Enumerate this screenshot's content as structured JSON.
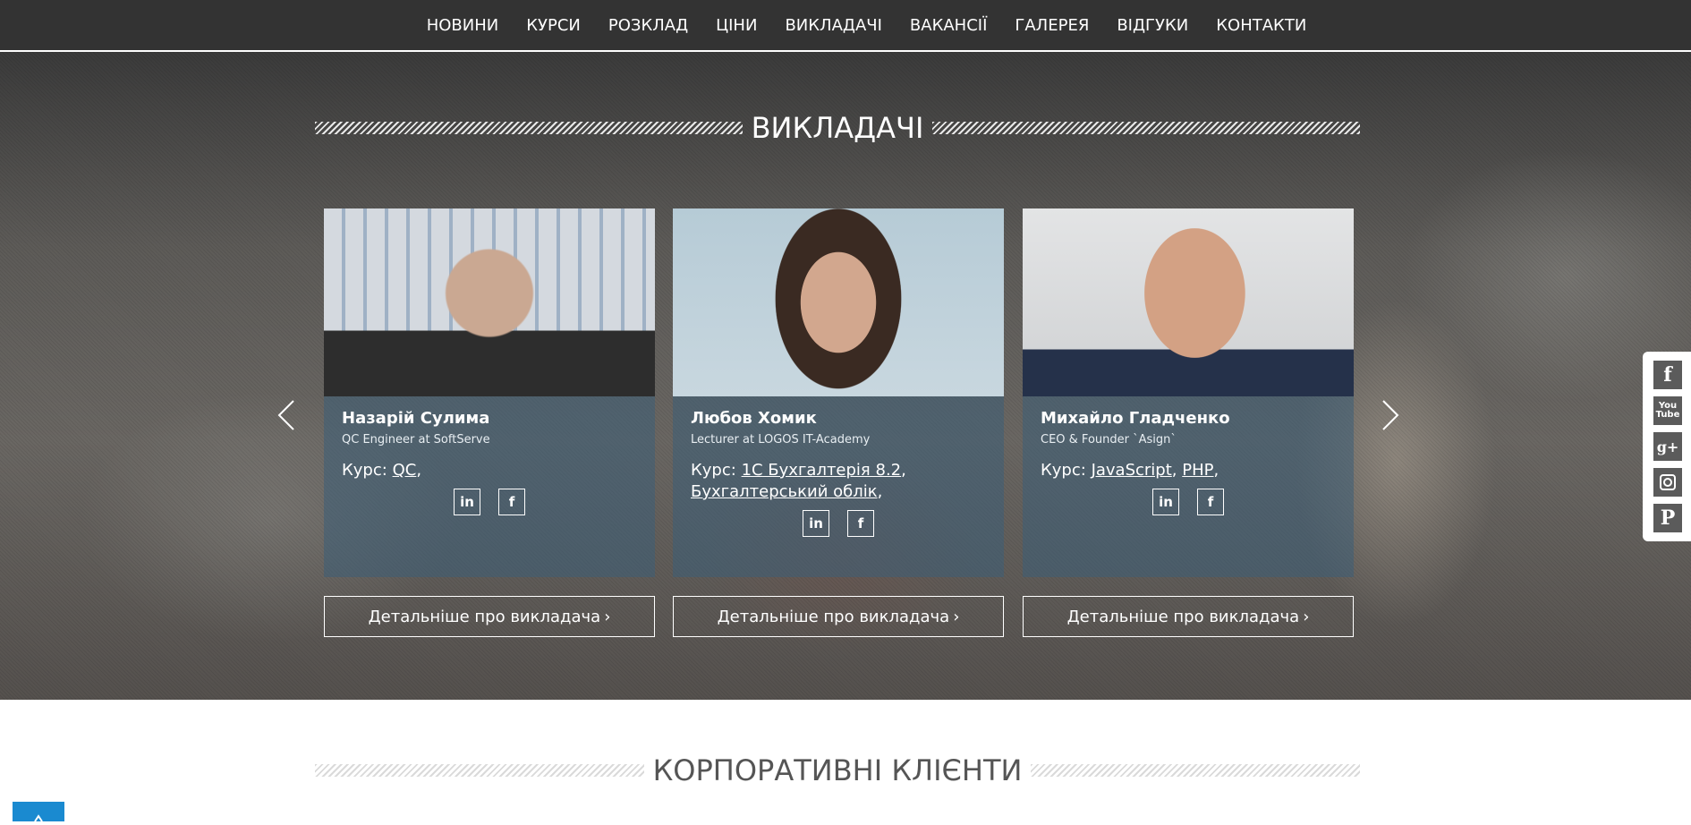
{
  "nav": {
    "items": [
      {
        "label": "НОВИНИ"
      },
      {
        "label": "КУРСИ"
      },
      {
        "label": "РОЗКЛАД"
      },
      {
        "label": "ЦІНИ"
      },
      {
        "label": "ВИКЛАДАЧІ"
      },
      {
        "label": "ВАКАНСІЇ"
      },
      {
        "label": "ГАЛЕРЕЯ"
      },
      {
        "label": "ВІДГУКИ"
      },
      {
        "label": "КОНТАКТИ"
      }
    ]
  },
  "teachers_section": {
    "title": "ВИКЛАДАЧІ",
    "course_prefix": "Курс:",
    "more_label": "Детальніше про викладача",
    "cards": [
      {
        "name": "Назарій Сулима",
        "position": "QC Engineer at SoftServe",
        "courses": [
          "QC"
        ]
      },
      {
        "name": "Любов Хомик",
        "position": "Lecturer at LOGOS IT-Academy",
        "courses": [
          "1С Бухгалтерія 8.2",
          "Бухгалтерський облік"
        ]
      },
      {
        "name": "Михайло Гладченко",
        "position": "CEO & Founder `Asign`",
        "courses": [
          "JavaScript",
          "PHP"
        ]
      }
    ]
  },
  "corporate_section": {
    "title": "КОРПОРАТИВНІ КЛІЄНТИ"
  },
  "social_sidebar": {
    "icons": [
      "facebook-icon",
      "youtube-icon",
      "google-plus-icon",
      "instagram-icon",
      "pinterest-icon"
    ]
  },
  "colors": {
    "nav_bg": "#333333",
    "card_overlay": "#3c5f78",
    "scroll_top": "#1a8ad0"
  }
}
